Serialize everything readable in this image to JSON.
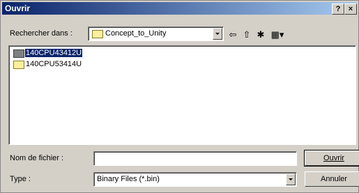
{
  "window": {
    "title": "Ouvrir",
    "help": "?",
    "close": "×"
  },
  "lookin": {
    "label": "Rechercher dans :",
    "value": "Concept_to_Unity"
  },
  "files": [
    {
      "name": "140CPU43412U",
      "selected": true
    },
    {
      "name": "140CPU53414U",
      "selected": false
    }
  ],
  "filename": {
    "label": "Nom de fichier :",
    "value": ""
  },
  "filetype": {
    "label": "Type :",
    "value": "Binary Files (*.bin)"
  },
  "buttons": {
    "open": "Ouvrir",
    "cancel": "Annuler"
  },
  "icons": [
    "back-icon",
    "up-folder-icon",
    "new-folder-icon",
    "view-menu-icon"
  ]
}
